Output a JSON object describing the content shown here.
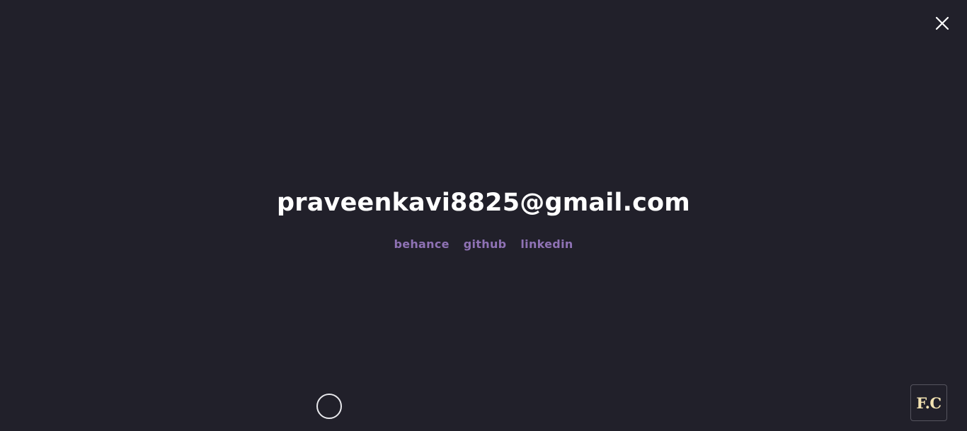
{
  "colors": {
    "background": "#21202a",
    "email_text": "#ffffff",
    "social_link": "#8f72b5",
    "logo_text": "#f3e3b2"
  },
  "header": {
    "close_icon": "close-icon"
  },
  "contact": {
    "email": "praveenkavi8825@gmail.com",
    "socials": [
      {
        "label": "behance"
      },
      {
        "label": "github"
      },
      {
        "label": "linkedin"
      }
    ]
  },
  "logo": {
    "text": "F.C"
  }
}
